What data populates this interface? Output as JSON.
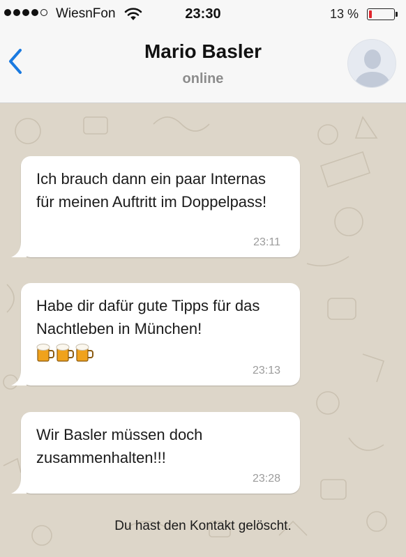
{
  "status_bar": {
    "carrier": "WiesnFon",
    "time": "23:30",
    "battery_text": "13 %",
    "battery_level": 0.13,
    "signal_bars_filled": 4,
    "signal_bars_total": 5,
    "battery_color": "#e0262d"
  },
  "header": {
    "contact_name": "Mario Basler",
    "status": "online",
    "back_icon": "chevron-left-icon",
    "accent_color": "#1a7ae0"
  },
  "messages": [
    {
      "text": "Ich brauch dann ein paar Internas für meinen Auftritt im Doppelpass!",
      "time": "23:11"
    },
    {
      "text": "Habe dir dafür gute Tipps für das Nachtleben in München!",
      "emoji": "beer-mug-icon x3",
      "time": "23:13"
    },
    {
      "text": "Wir Basler müssen doch zusammenhalten!!!",
      "time": "23:28"
    }
  ],
  "system_notice": "Du hast den Kontakt gelöscht."
}
